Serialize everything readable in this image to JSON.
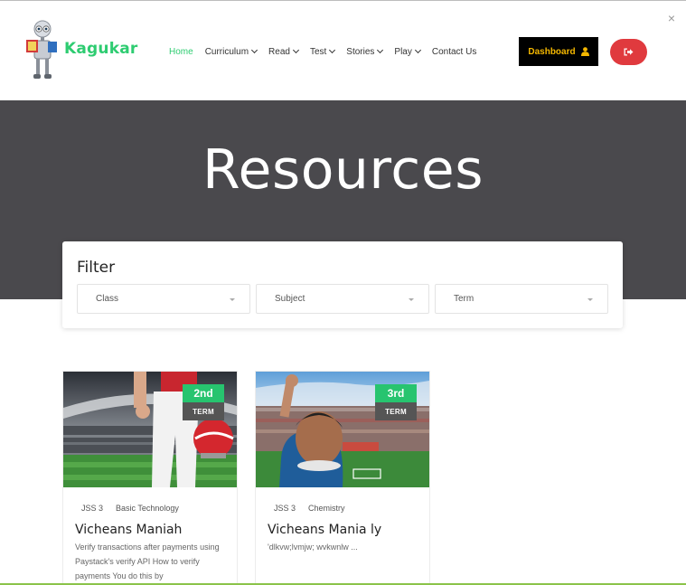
{
  "header": {
    "logo_text": "Kagukar",
    "close_symbol": "×",
    "nav": [
      {
        "label": "Home",
        "has_dropdown": false,
        "active": true
      },
      {
        "label": "Curriculum",
        "has_dropdown": true,
        "active": false
      },
      {
        "label": "Read",
        "has_dropdown": true,
        "active": false
      },
      {
        "label": "Test",
        "has_dropdown": true,
        "active": false
      },
      {
        "label": "Stories",
        "has_dropdown": true,
        "active": false
      },
      {
        "label": "Play",
        "has_dropdown": true,
        "active": false
      },
      {
        "label": "Contact Us",
        "has_dropdown": false,
        "active": false
      }
    ],
    "dashboard_label": "Dashboard",
    "dashboard_icon": "user-icon",
    "logout_icon": "sign-out-icon"
  },
  "hero": {
    "title": "Resources"
  },
  "filter": {
    "title": "Filter",
    "selects": [
      {
        "placeholder": "Class"
      },
      {
        "placeholder": "Subject"
      },
      {
        "placeholder": "Term"
      }
    ]
  },
  "cards": [
    {
      "term_number": "2nd",
      "term_label": "TERM",
      "class": "JSS 3",
      "subject": "Basic Technology",
      "title": "Vicheans Maniah",
      "description": "Verify transactions after payments using Paystack's verify API How to verify payments You do this by"
    },
    {
      "term_number": "3rd",
      "term_label": "TERM",
      "class": "JSS 3",
      "subject": "Chemistry",
      "title": "Vicheans Mania ly",
      "description": "'dlkvw;lvmjw; wvkwnlw ..."
    }
  ],
  "colors": {
    "accent_green": "#2ecc71",
    "hero_bg": "#4a494d",
    "dashboard_bg": "#000000",
    "dashboard_text": "#f5b800",
    "logout_bg": "#e03a3e",
    "badge_green": "#27c46f",
    "badge_grey": "#555555"
  }
}
